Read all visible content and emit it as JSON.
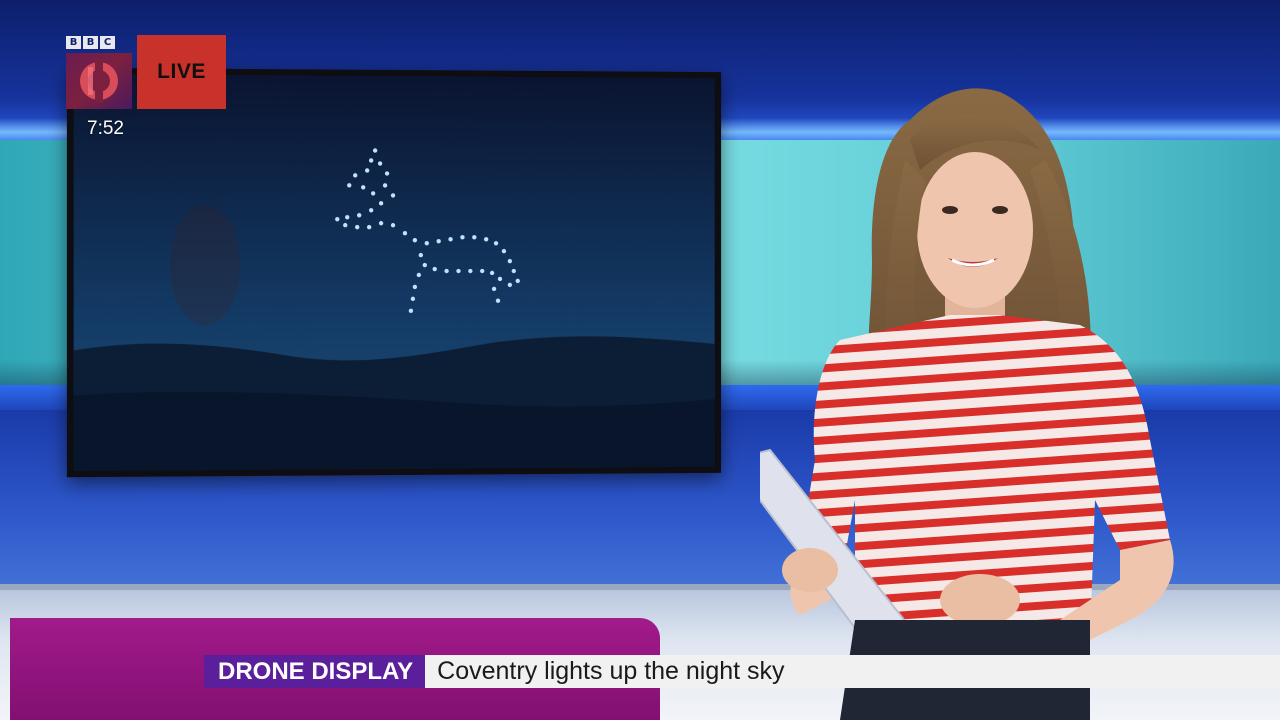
{
  "broadcast": {
    "network_letters": [
      "B",
      "B",
      "C"
    ],
    "live_label": "LIVE",
    "clock": "7:52"
  },
  "lower_third": {
    "tag": "DRONE DISPLAY",
    "headline": "Coventry lights up the night sky"
  },
  "colors": {
    "live_red": "#c8322a",
    "tag_purple": "#5b1f9c",
    "strap_bg": "#f1f1f1"
  },
  "icons": {
    "channel_logo": "bbc-channel-logo-icon"
  }
}
